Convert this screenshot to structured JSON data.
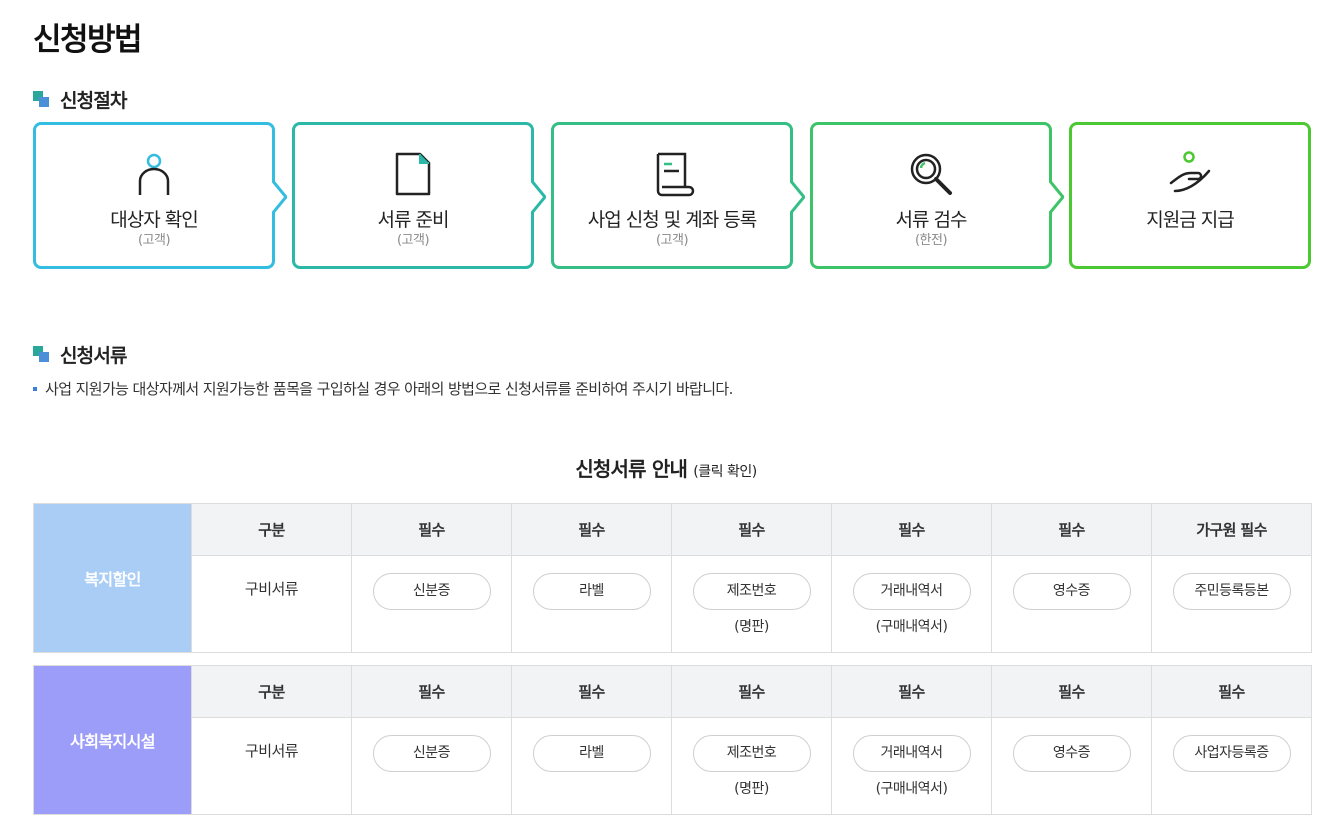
{
  "page_title": "신청방법",
  "procedure": {
    "title": "신청절차",
    "steps": [
      {
        "label": "대상자 확인",
        "sub": "(고객)",
        "color": "#33bde0",
        "icon": "person-icon"
      },
      {
        "label": "서류 준비",
        "sub": "(고객)",
        "color": "#2bb8a6",
        "icon": "document-icon"
      },
      {
        "label": "사업 신청 및 계좌 등록",
        "sub": "(고객)",
        "color": "#35be86",
        "icon": "scroll-icon"
      },
      {
        "label": "서류 검수",
        "sub": "(한전)",
        "color": "#3ec468",
        "icon": "magnifier-icon"
      },
      {
        "label": "지원금 지급",
        "sub": "",
        "color": "#4cc832",
        "icon": "hand-coin-icon"
      }
    ]
  },
  "documents": {
    "title": "신청서류",
    "notice": "사업 지원가능 대상자께서 지원가능한 품목을 구입하실 경우 아래의 방법으로 신청서류를 준비하여 주시기 바랍니다.",
    "guide_title": "신청서류 안내",
    "guide_hint": "(클릭 확인)",
    "tables": [
      {
        "category": "복지할인",
        "category_color": "#a9cdf5",
        "headers": [
          "구분",
          "필수",
          "필수",
          "필수",
          "필수",
          "필수",
          "가구원 필수"
        ],
        "row_label": "구비서류",
        "items": [
          {
            "label": "신분증",
            "sub": ""
          },
          {
            "label": "라벨",
            "sub": ""
          },
          {
            "label": "제조번호",
            "sub": "(명판)"
          },
          {
            "label": "거래내역서",
            "sub": "(구매내역서)"
          },
          {
            "label": "영수증",
            "sub": ""
          },
          {
            "label": "주민등록등본",
            "sub": ""
          }
        ]
      },
      {
        "category": "사회복지시설",
        "category_color": "#9c9cf9",
        "headers": [
          "구분",
          "필수",
          "필수",
          "필수",
          "필수",
          "필수",
          "필수"
        ],
        "row_label": "구비서류",
        "items": [
          {
            "label": "신분증",
            "sub": ""
          },
          {
            "label": "라벨",
            "sub": ""
          },
          {
            "label": "제조번호",
            "sub": "(명판)"
          },
          {
            "label": "거래내역서",
            "sub": "(구매내역서)"
          },
          {
            "label": "영수증",
            "sub": ""
          },
          {
            "label": "사업자등록증",
            "sub": ""
          }
        ]
      }
    ]
  }
}
